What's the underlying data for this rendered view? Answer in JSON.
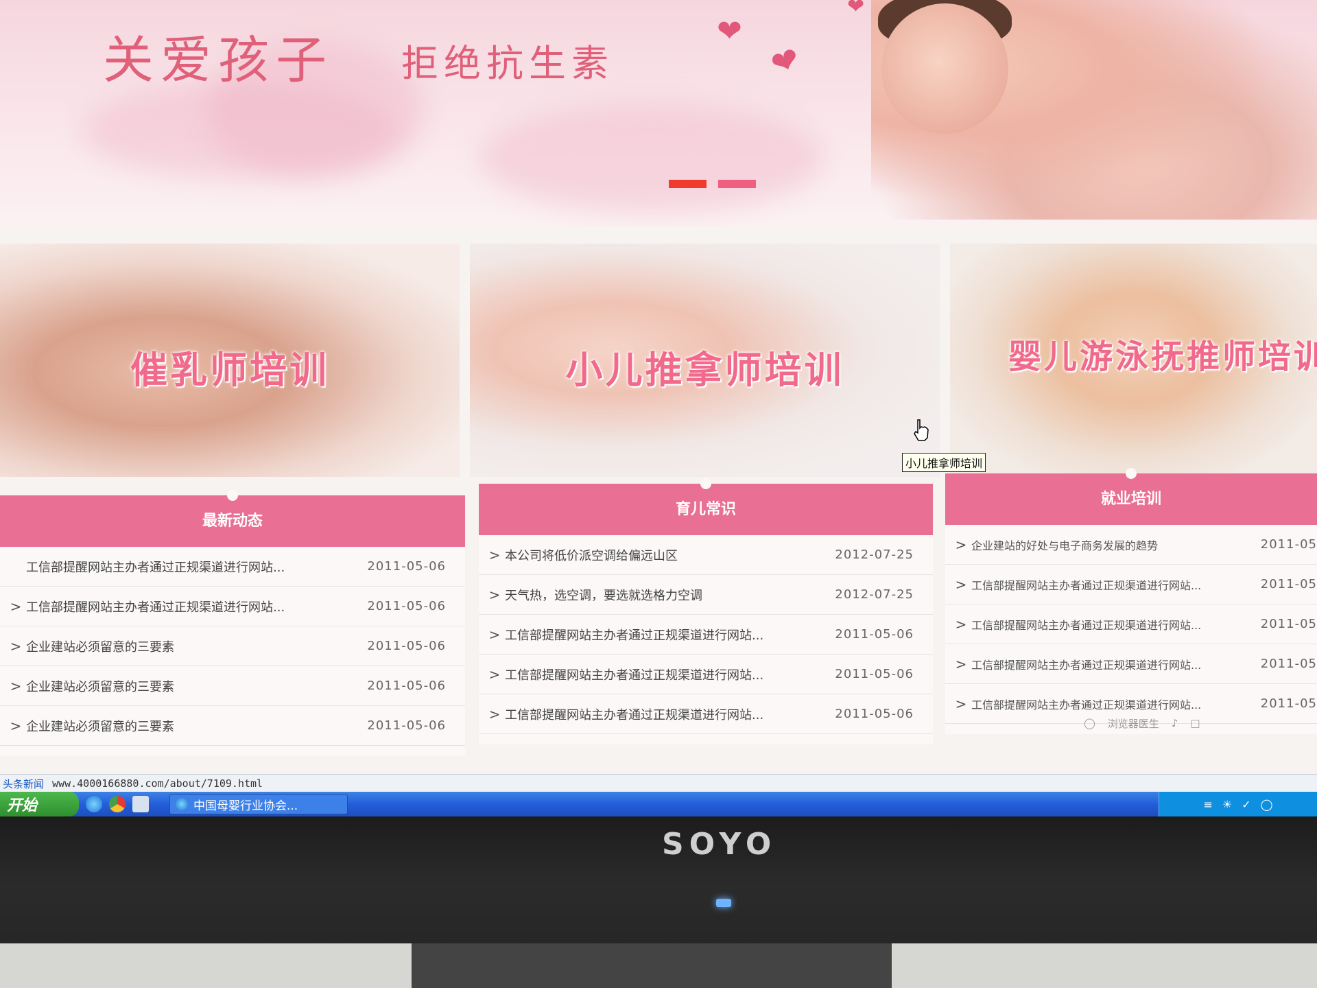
{
  "banner": {
    "slogan_main": "关爱孩子",
    "slogan_sub": "拒绝抗生素",
    "slides_total": 2,
    "slides_active": 1,
    "dot_colors": [
      "#ee3b2c",
      "#ef5f7f"
    ]
  },
  "tiles": [
    {
      "label": "催乳师培训"
    },
    {
      "label": "小儿推拿师培训"
    },
    {
      "label": "婴儿游泳抚推师培训"
    }
  ],
  "tooltip": "小儿推拿师培训",
  "columns": {
    "latest": {
      "title": "最新动态",
      "items": [
        {
          "title": "工信部提醒网站主办者通过正规渠道进行网站...",
          "date": "2011-05-06"
        },
        {
          "title": "工信部提醒网站主办者通过正规渠道进行网站...",
          "date": "2011-05-06"
        },
        {
          "title": "企业建站必须留意的三要素",
          "date": "2011-05-06"
        },
        {
          "title": "企业建站必须留意的三要素",
          "date": "2011-05-06"
        },
        {
          "title": "企业建站必须留意的三要素",
          "date": "2011-05-06"
        }
      ]
    },
    "parenting": {
      "title": "育儿常识",
      "items": [
        {
          "title": "本公司将低价派空调给偏远山区",
          "date": "2012-07-25"
        },
        {
          "title": "天气热，选空调，要选就选格力空调",
          "date": "2012-07-25"
        },
        {
          "title": "工信部提醒网站主办者通过正规渠道进行网站...",
          "date": "2011-05-06"
        },
        {
          "title": "工信部提醒网站主办者通过正规渠道进行网站...",
          "date": "2011-05-06"
        },
        {
          "title": "工信部提醒网站主办者通过正规渠道进行网站...",
          "date": "2011-05-06"
        }
      ]
    },
    "employment": {
      "title": "就业培训",
      "items": [
        {
          "title": "企业建站的好处与电子商务发展的趋势",
          "date": "2011-05"
        },
        {
          "title": "工信部提醒网站主办者通过正规渠道进行网站...",
          "date": "2011-05"
        },
        {
          "title": "工信部提醒网站主办者通过正规渠道进行网站...",
          "date": "2011-05"
        },
        {
          "title": "工信部提醒网站主办者通过正规渠道进行网站...",
          "date": "2011-05"
        },
        {
          "title": "工信部提醒网站主办者通过正规渠道进行网站...",
          "date": "2011-05"
        }
      ]
    }
  },
  "statusbar": {
    "news_label": "头条新闻",
    "url": "www.4000166880.com/about/7109.html"
  },
  "taskbar": {
    "start_label": "开始",
    "task_label": "中国母婴行业协会...",
    "tray_extra": "浏览器医生"
  },
  "monitor": {
    "brand": "SOYO"
  }
}
